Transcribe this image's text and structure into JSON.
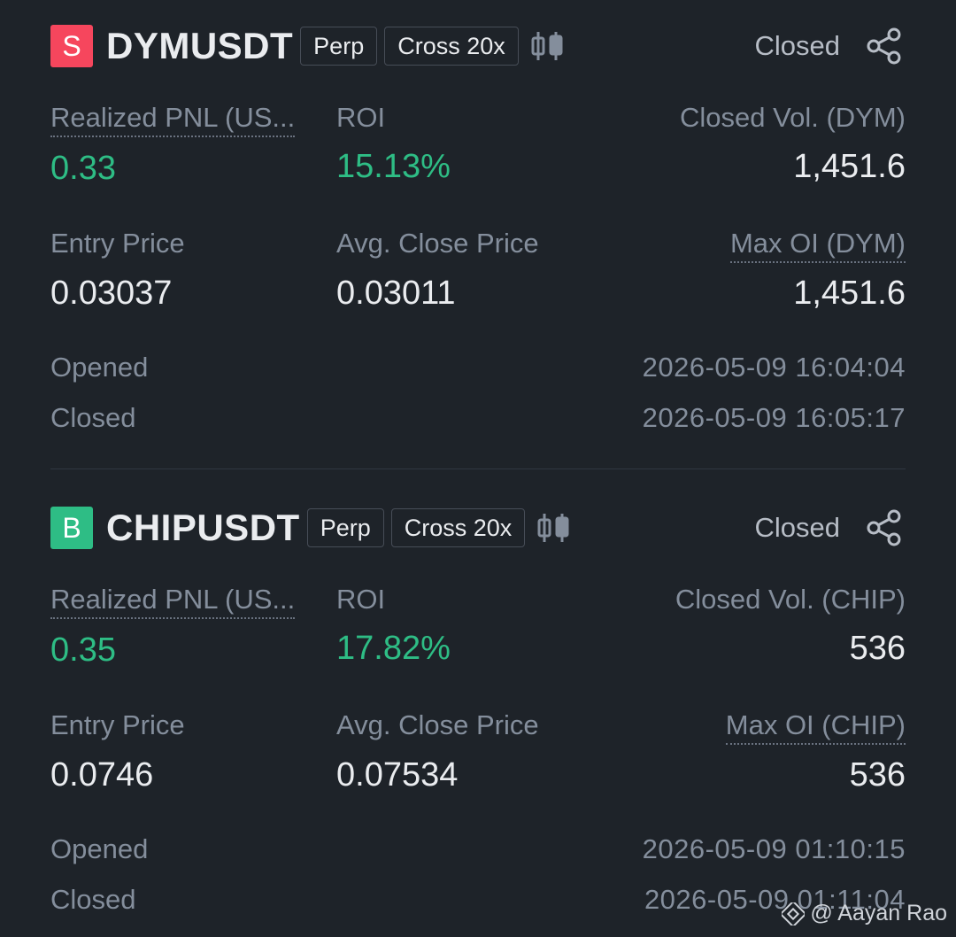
{
  "colors": {
    "background": "#1e2329",
    "short_badge": "#f6465d",
    "long_badge": "#2ebd85",
    "profit_green": "#2ebd85",
    "muted_text": "#848e9c",
    "primary_text": "#eaecef"
  },
  "positions": [
    {
      "side_letter": "S",
      "side_color": "#f6465d",
      "symbol": "DYMUSDT",
      "tag_type": "Perp",
      "tag_margin": "Cross 20x",
      "chart_icon": "candlestick-chart-icon",
      "status": "Closed",
      "share_icon": "share-icon",
      "realized_pnl_label": "Realized PNL (US...",
      "realized_pnl": "0.33",
      "roi_label": "ROI",
      "roi": "15.13%",
      "closed_vol_label": "Closed Vol. (DYM)",
      "closed_vol": "1,451.6",
      "entry_price_label": "Entry Price",
      "entry_price": "0.03037",
      "avg_close_label": "Avg. Close Price",
      "avg_close": "0.03011",
      "max_oi_label": "Max OI (DYM)",
      "max_oi": "1,451.6",
      "opened_label": "Opened",
      "opened": "2026-05-09 16:04:04",
      "closed_label": "Closed",
      "closed": "2026-05-09 16:05:17"
    },
    {
      "side_letter": "B",
      "side_color": "#2ebd85",
      "symbol": "CHIPUSDT",
      "tag_type": "Perp",
      "tag_margin": "Cross 20x",
      "chart_icon": "candlestick-chart-icon",
      "status": "Closed",
      "share_icon": "share-icon",
      "realized_pnl_label": "Realized PNL (US...",
      "realized_pnl": "0.35",
      "roi_label": "ROI",
      "roi": "17.82%",
      "closed_vol_label": "Closed Vol. (CHIP)",
      "closed_vol": "536",
      "entry_price_label": "Entry Price",
      "entry_price": "0.0746",
      "avg_close_label": "Avg. Close Price",
      "avg_close": "0.07534",
      "max_oi_label": "Max OI (CHIP)",
      "max_oi": "536",
      "opened_label": "Opened",
      "opened": "2026-05-09 01:10:15",
      "closed_label": "Closed",
      "closed": "2026-05-09 01:11:04"
    }
  ],
  "watermark": {
    "icon": "binance-logo-icon",
    "text": "@ Aayan Rao"
  }
}
